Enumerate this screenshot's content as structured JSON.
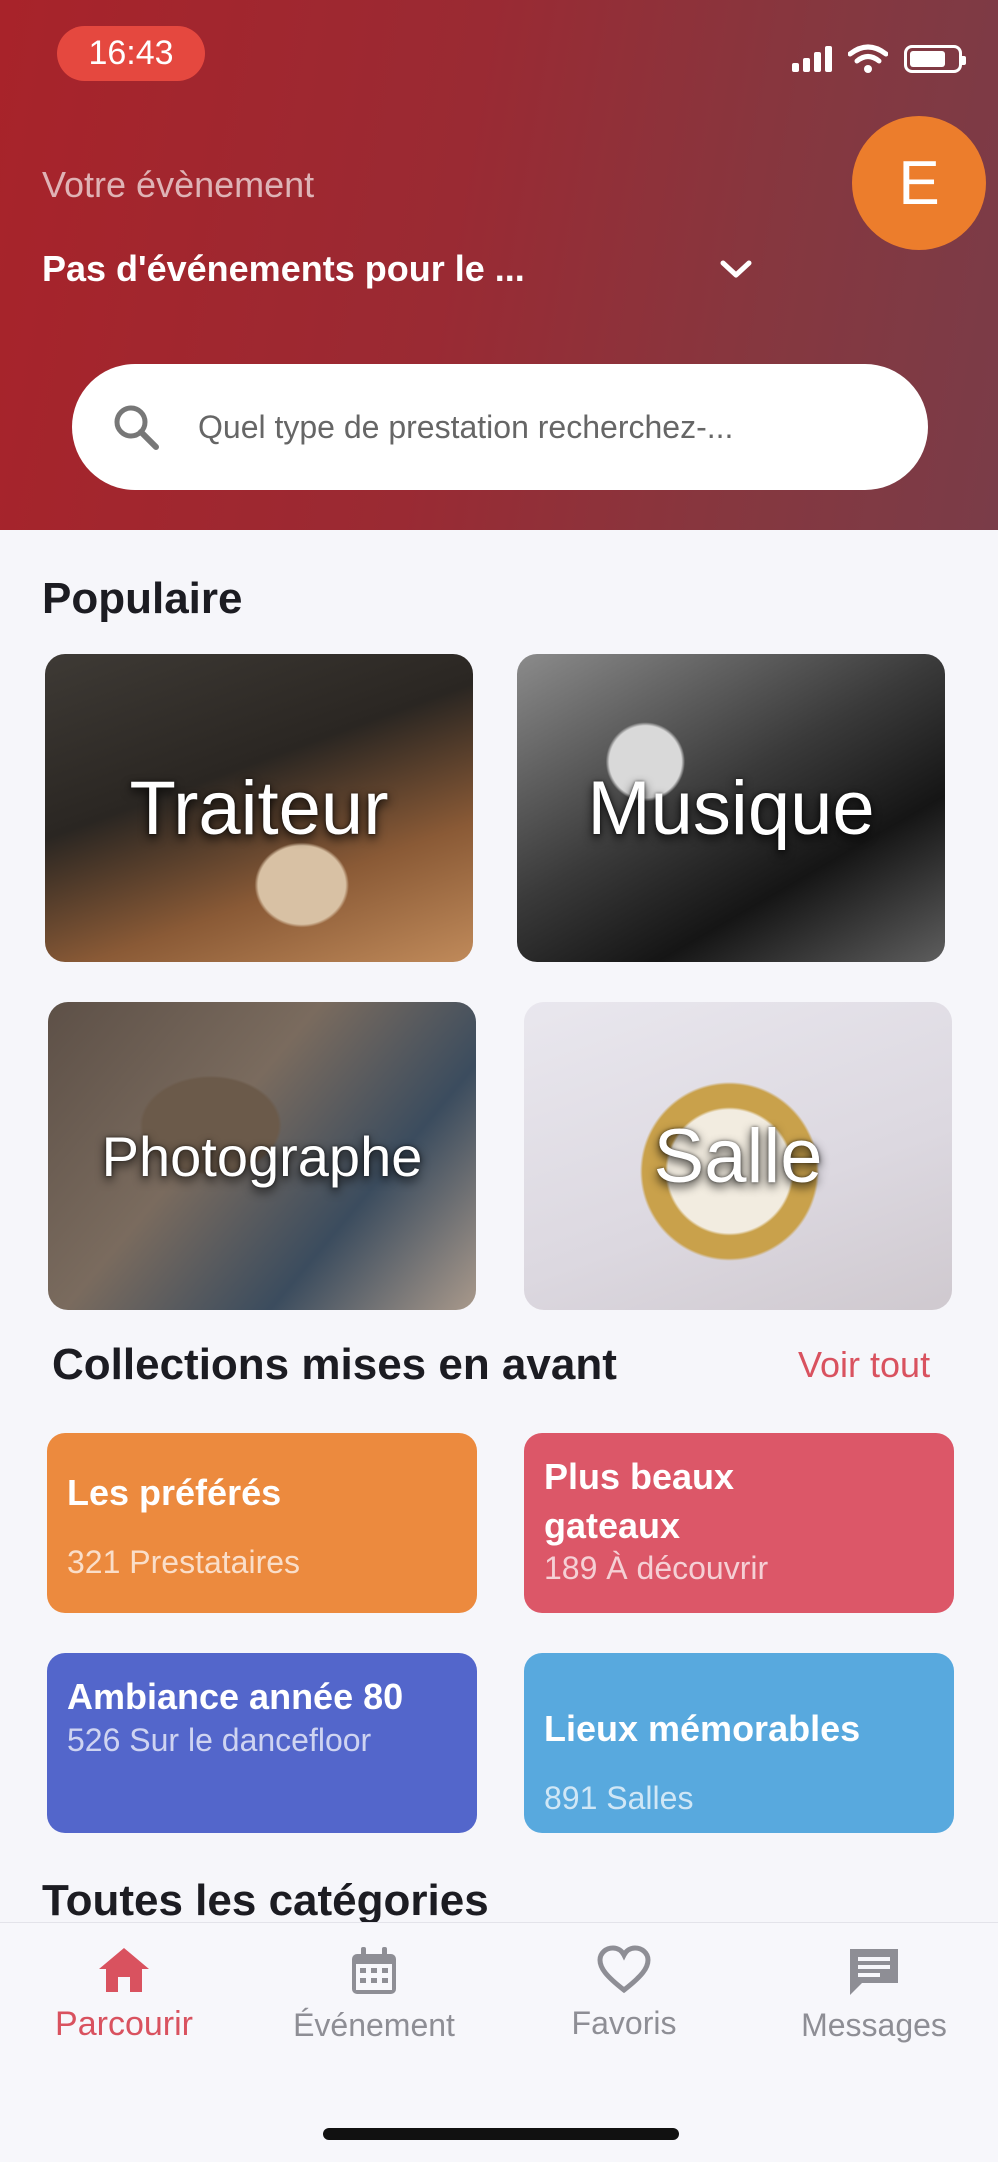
{
  "status_bar": {
    "time": "16:43",
    "battery_level": 0.75
  },
  "header": {
    "event_label": "Votre évènement",
    "event_value": "Pas d'événements pour le ...",
    "avatar_initial": "E",
    "search_placeholder": "Quel type de prestation recherchez-..."
  },
  "popular": {
    "title": "Populaire",
    "tiles": [
      {
        "label": "Traiteur"
      },
      {
        "label": "Musique"
      },
      {
        "label": "Photographe"
      },
      {
        "label": "Salle"
      }
    ]
  },
  "collections": {
    "title": "Collections mises en avant",
    "see_all": "Voir tout",
    "items": [
      {
        "name": "Les préférés",
        "count": "321 Prestataires",
        "color": "#ec8a3e"
      },
      {
        "name": "Plus beaux gateaux",
        "count": "189 À découvrir",
        "color": "#dc5768"
      },
      {
        "name": "Ambiance année 80",
        "count": "526 Sur le dancefloor",
        "color": "#5366cb"
      },
      {
        "name": "Lieux mémorables",
        "count": "891 Salles",
        "color": "#58a9de"
      }
    ]
  },
  "categories": {
    "title": "Toutes les catégories"
  },
  "tabbar": {
    "items": [
      {
        "label": "Parcourir",
        "icon": "home-icon",
        "active": true
      },
      {
        "label": "Événement",
        "icon": "calendar-icon",
        "active": false
      },
      {
        "label": "Favoris",
        "icon": "heart-icon",
        "active": false
      },
      {
        "label": "Messages",
        "icon": "message-icon",
        "active": false
      }
    ]
  },
  "colors": {
    "accent": "#d9525f",
    "header_start": "#a8232a",
    "header_end": "#7a3c48"
  }
}
